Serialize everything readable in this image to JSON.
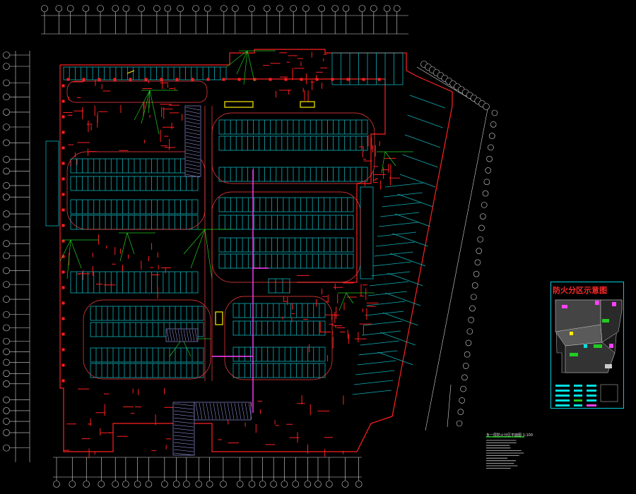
{
  "legend": {
    "title": "防火分区示意图"
  },
  "drawing": {
    "title": "负一层防火分区平面图",
    "scale": "1:100"
  },
  "colors": {
    "background": "#000000",
    "wall": "#ff2020",
    "parking": "#10b0b8",
    "annotation": "#22cc22",
    "dimension": "#d8d8d8",
    "zone_line": "#ff40ff",
    "panel_border": "#00cfd8",
    "hatch": "#a8a8ff",
    "highlight": "#ffee00"
  }
}
